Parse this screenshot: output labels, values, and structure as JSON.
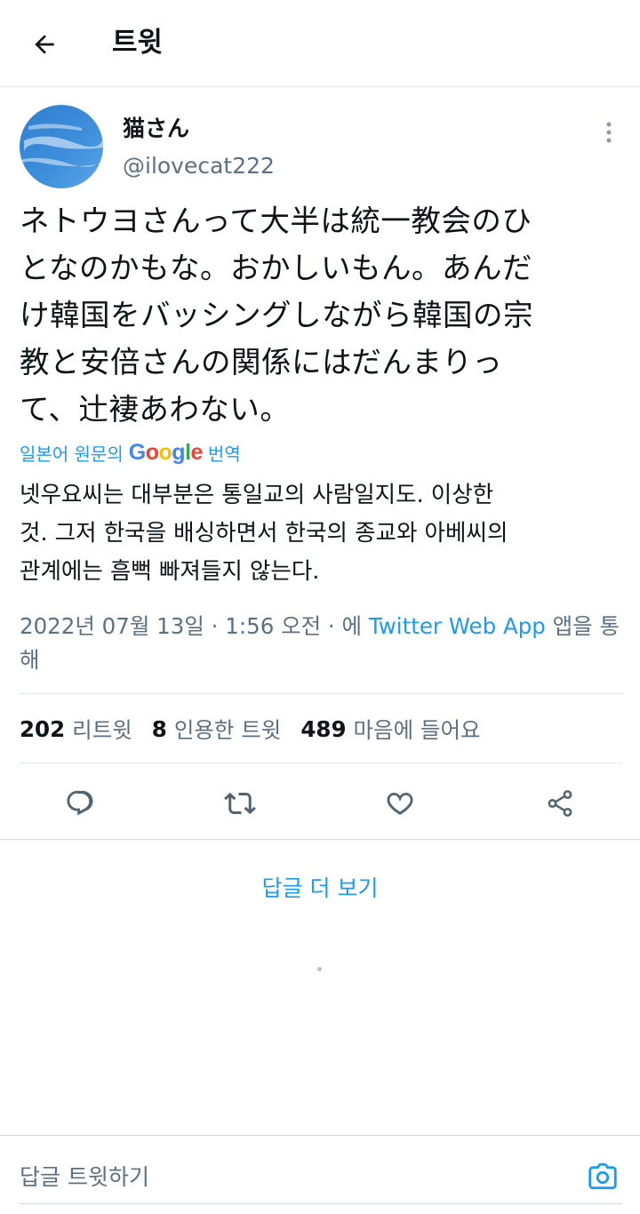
{
  "header": {
    "title": "트윗",
    "back_icon": "arrow-left-icon"
  },
  "tweet": {
    "display_name": "猫さん",
    "handle": "@ilovecat222",
    "text": "ネトウヨさんって大半は統一教会のひ\nとなのかもな。おかしいもん。あんだ\nけ韓国をバッシングしながら韓国の宗\n教と安倍さんの関係にはだんまりっ\nて、辻褄あわない。",
    "translate": {
      "prefix": "일본어 원문의",
      "provider": "Google",
      "suffix": "번역"
    },
    "translated_text": "넷우요씨는 대부분은 통일교의 사람일지도. 이상한\n것. 그저 한국을 배싱하면서 한국의 종교와 아베씨의\n관계에는 흠뻑 빠져들지 않는다.",
    "meta": {
      "timestamp": "2022년 07월 13일 · 1:56 오전 · 에",
      "client": "Twitter Web App",
      "suffix": "앱을 통해"
    },
    "stats": {
      "retweets": {
        "count": "202",
        "label": "리트윗"
      },
      "quotes": {
        "count": "8",
        "label": "인용한 트윗"
      },
      "likes": {
        "count": "489",
        "label": "마음에 들어요"
      }
    }
  },
  "more_replies": "답글 더 보기",
  "reply_bar": {
    "placeholder": "답글 트윗하기"
  },
  "colors": {
    "accent": "#1d9bf0",
    "secondary_text": "#5b7083",
    "divider": "#e1e8ed",
    "icon": "#536471"
  }
}
